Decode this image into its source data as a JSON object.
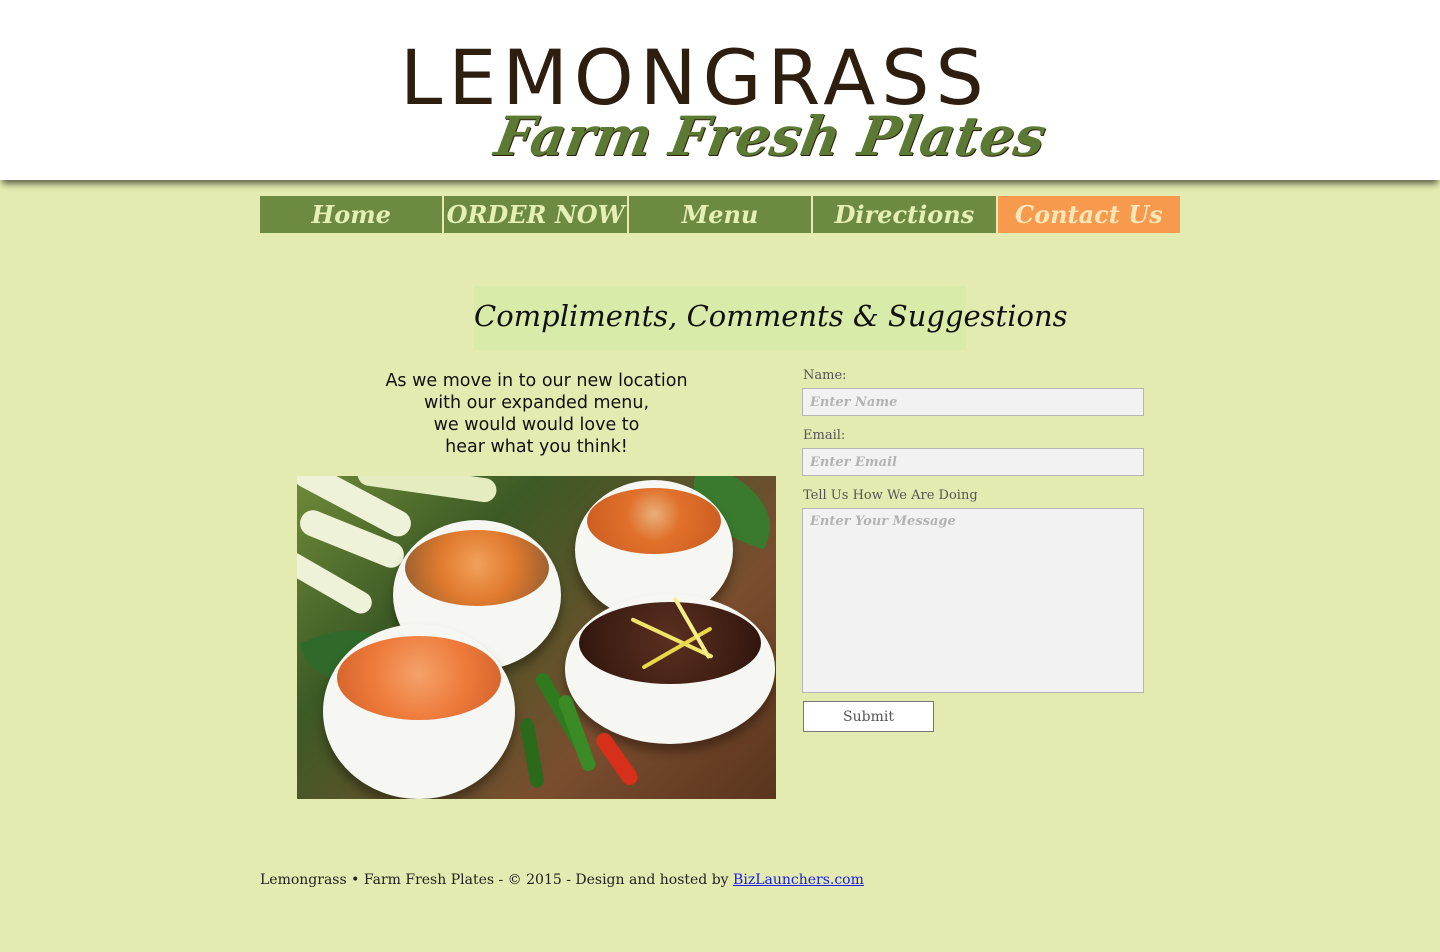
{
  "header": {
    "logo_main": "LEMONGRASS",
    "logo_sub": "Farm Fresh Plates"
  },
  "nav": {
    "items": [
      {
        "label": "Home"
      },
      {
        "label": "ORDER NOW"
      },
      {
        "label": "Menu"
      },
      {
        "label": "Directions"
      },
      {
        "label": "Contact Us"
      }
    ],
    "active": "Contact Us"
  },
  "main": {
    "heading": "Compliments, Comments & Suggestions",
    "intro_lines": [
      "As we move in to our new location",
      "with our expanded menu,",
      "we would would love to",
      "hear what you think!"
    ]
  },
  "form": {
    "name_label": "Name:",
    "name_placeholder": "Enter Name",
    "email_label": "Email:",
    "email_placeholder": "Enter Email",
    "message_label": "Tell Us How We Are Doing",
    "message_placeholder": "Enter Your Message",
    "submit_label": "Submit"
  },
  "footer": {
    "text": "Lemongrass  • Farm Fresh Plates - © 2015 - Design and hosted by ",
    "link_text": "BizLaunchers.com"
  },
  "colors": {
    "page_bg": "#e3ebb0",
    "nav_green": "#6c8a42",
    "nav_active": "#f79a4e",
    "heading_bg": "#d8eba8",
    "logo_brown": "#2e1e10",
    "logo_green": "#5c7a33"
  }
}
